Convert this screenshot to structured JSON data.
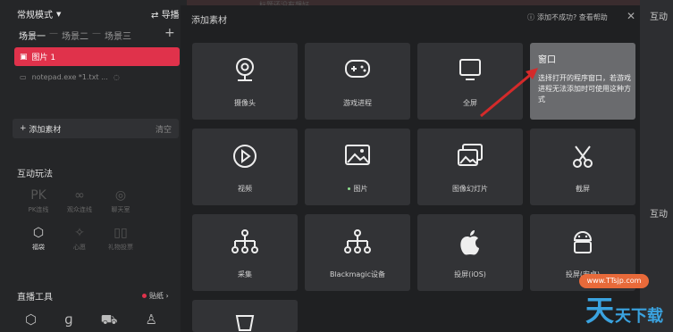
{
  "left": {
    "mode": "常规模式",
    "guide": "导播",
    "tabs": [
      "场景一",
      "场景二",
      "场景三"
    ],
    "tab_sep": "—",
    "selected_source": "图片 1",
    "notepad_source": "notepad.exe *1.txt ...",
    "add_source": "添加素材",
    "clear": "清空",
    "section_interactive": "互动玩法",
    "interactive_items": [
      {
        "label": "PK连线",
        "icon": "pk-icon",
        "lit": false
      },
      {
        "label": "观众连线",
        "icon": "link-icon",
        "lit": false
      },
      {
        "label": "聊天室",
        "icon": "chat-icon",
        "lit": false
      },
      {
        "label": "福袋",
        "icon": "gift-bag-icon",
        "lit": true
      },
      {
        "label": "心愿",
        "icon": "wish-icon",
        "lit": false
      },
      {
        "label": "礼物投票",
        "icon": "vote-icon",
        "lit": false
      }
    ],
    "section_tools": "直播工具",
    "sticker": "贴纸"
  },
  "right_strip": {
    "label1": "互动",
    "label2": "互动"
  },
  "top_faded": "标题还没有想好",
  "dialog": {
    "title": "添加素材",
    "help_text": "添加不成功? 查看帮助",
    "cards": [
      {
        "label": "摄像头",
        "icon": "camera-icon"
      },
      {
        "label": "游戏进程",
        "icon": "gamepad-icon"
      },
      {
        "label": "全屏",
        "icon": "monitor-icon"
      },
      {
        "label": "窗口",
        "icon": "window-icon"
      },
      {
        "label": "视频",
        "icon": "play-icon"
      },
      {
        "label": "图片",
        "icon": "image-icon"
      },
      {
        "label": "图像幻灯片",
        "icon": "slideshow-icon"
      },
      {
        "label": "截屏",
        "icon": "scissors-icon"
      },
      {
        "label": "采集",
        "icon": "capture-icon"
      },
      {
        "label": "Blackmagic设备",
        "icon": "blackmagic-icon"
      },
      {
        "label": "投屏(iOS)",
        "icon": "apple-icon"
      },
      {
        "label": "投屏(安卓)",
        "icon": "android-icon"
      },
      {
        "label": "",
        "icon": "misc-icon"
      }
    ],
    "window_tooltip_title": "窗口",
    "window_tooltip_desc": "选择打开的程序窗口，若游戏进程无法添加时可使用这种方式"
  },
  "watermark": {
    "url": "www.TTsjp.com",
    "big": "天",
    "small": "天下载"
  },
  "colors": {
    "accent": "#e0324b",
    "dialog_bg": "#1f2022",
    "card_bg": "#323336",
    "arrow": "#d42a2a"
  }
}
